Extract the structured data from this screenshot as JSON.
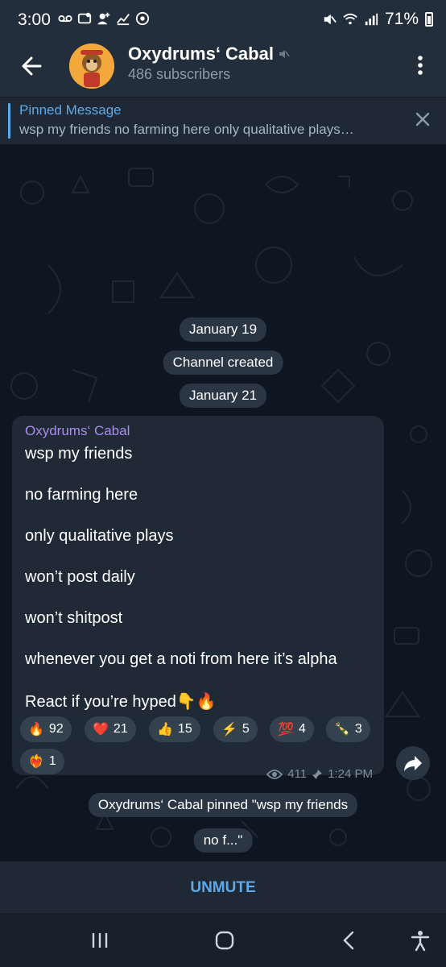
{
  "status_bar": {
    "time": "3:00",
    "battery": "71%",
    "icons": [
      "voicemail-icon",
      "notification-icon",
      "add-user-icon",
      "stocks-icon",
      "chrome-icon",
      "mute-icon",
      "wifi-icon",
      "signal-icon",
      "battery-icon"
    ]
  },
  "header": {
    "title": "Oxydrums‘ Cabal",
    "subtitle": "486 subscribers"
  },
  "pinned": {
    "label": "Pinned Message",
    "text": "wsp my friends  no farming here  only qualitative plays…"
  },
  "chat": {
    "date_1": "January 19",
    "service_created": "Channel created",
    "date_2": "January 21",
    "message": {
      "author": "Oxydrums‘ Cabal",
      "lines": [
        "wsp my friends",
        "no farming here",
        "only qualitative plays",
        "won’t post daily",
        "won’t shitpost",
        "whenever you get a noti from here it’s alpha",
        "React if you’re hyped👇🔥"
      ],
      "reactions": [
        {
          "emoji": "🔥",
          "count": "92"
        },
        {
          "emoji": "❤️",
          "count": "21"
        },
        {
          "emoji": "👍",
          "count": "15"
        },
        {
          "emoji": "⚡",
          "count": "5"
        },
        {
          "emoji": "💯",
          "count": "4"
        },
        {
          "emoji": "🍾",
          "count": "3"
        },
        {
          "emoji": "❤️‍🔥",
          "count": "1"
        }
      ],
      "views": "411",
      "time": "1:24 PM"
    },
    "service_pinned_line1": "Oxydrums‘ Cabal pinned \"wsp my friends",
    "service_pinned_line2": "no f...\""
  },
  "bottom": {
    "unmute_label": "UNMUTE"
  },
  "colors": {
    "header_bg": "#232e3c",
    "chat_bg": "#0e1621",
    "accent": "#5ea9e8",
    "author": "#a98ded",
    "bubble": "#1f2a36"
  }
}
